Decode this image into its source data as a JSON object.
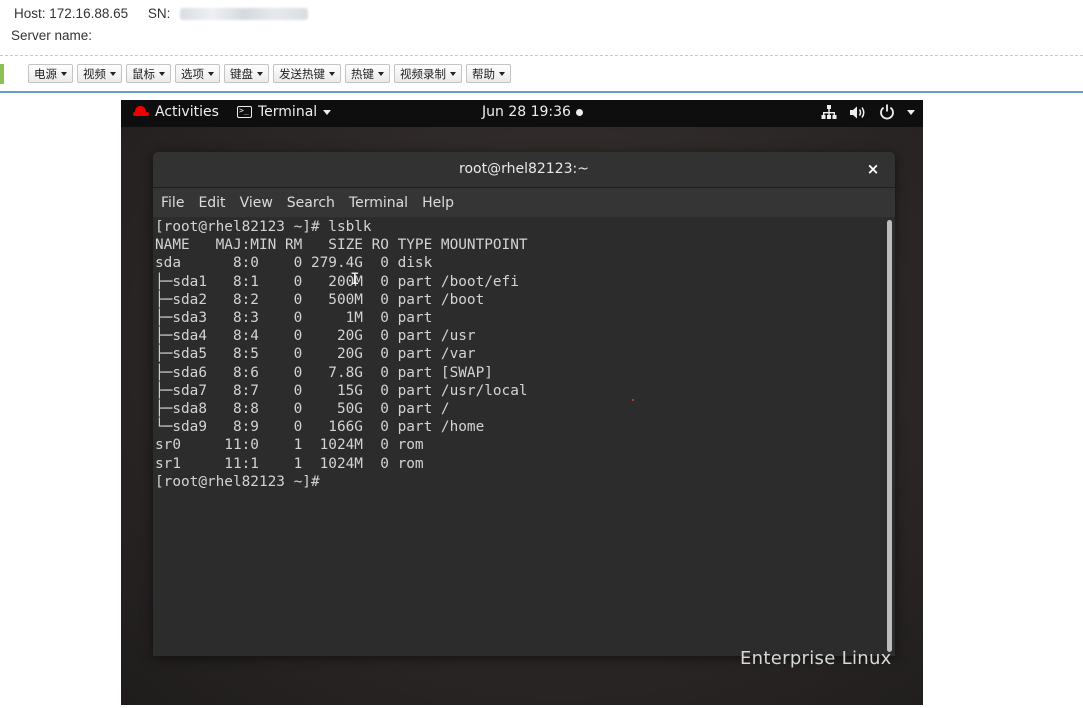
{
  "header": {
    "host_label": "Host:",
    "host_value": "172.16.88.65",
    "sn_label": "SN:",
    "server_name_label": "Server name:"
  },
  "toolbar": {
    "buttons": [
      {
        "label": "电源"
      },
      {
        "label": "视频"
      },
      {
        "label": "鼠标"
      },
      {
        "label": "选项"
      },
      {
        "label": "键盘"
      },
      {
        "label": "发送热键"
      },
      {
        "label": "热键"
      },
      {
        "label": "视频录制"
      },
      {
        "label": "帮助"
      }
    ]
  },
  "gnome": {
    "activities_label": "Activities",
    "app_menu_label": "Terminal",
    "clock": "Jun 28  19:36",
    "tray_icons": [
      "network-icon",
      "volume-icon",
      "power-icon",
      "chevron-down-icon"
    ]
  },
  "terminal": {
    "title": "root@rhel82123:~",
    "close_glyph": "×",
    "menu": [
      "File",
      "Edit",
      "View",
      "Search",
      "Terminal",
      "Help"
    ],
    "lines": [
      "[root@rhel82123 ~]# lsblk",
      "NAME   MAJ:MIN RM   SIZE RO TYPE MOUNTPOINT",
      "sda      8:0    0 279.4G  0 disk",
      "├─sda1   8:1    0   200M  0 part /boot/efi",
      "├─sda2   8:2    0   500M  0 part /boot",
      "├─sda3   8:3    0     1M  0 part",
      "├─sda4   8:4    0    20G  0 part /usr",
      "├─sda5   8:5    0    20G  0 part /var",
      "├─sda6   8:6    0   7.8G  0 part [SWAP]",
      "├─sda7   8:7    0    15G  0 part /usr/local",
      "├─sda8   8:8    0    50G  0 part /",
      "└─sda9   8:9    0   166G  0 part /home",
      "sr0     11:0    1  1024M  0 rom",
      "sr1     11:1    1  1024M  0 rom",
      "[root@rhel82123 ~]#"
    ]
  },
  "desktop": {
    "brand_text": "Enterprise Linux"
  },
  "colors": {
    "accent_green": "#8cc152",
    "separator_blue": "#6a9bcc",
    "redhat_red": "#ee0000",
    "terminal_bg": "#2c2c2c",
    "terminal_fg": "#d3d3d3"
  }
}
